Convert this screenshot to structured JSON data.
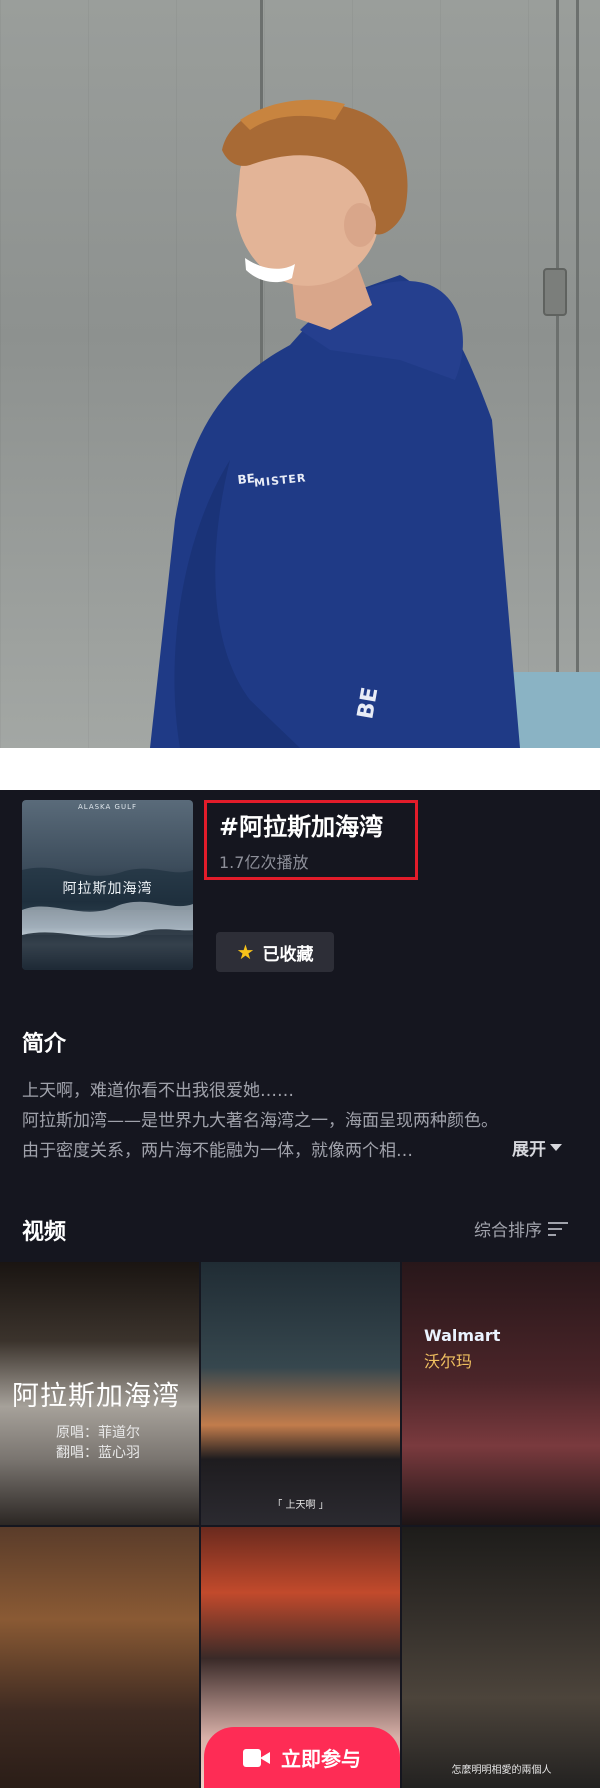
{
  "topic": {
    "cover_top_text": "ALASKA GULF",
    "cover_title": "阿拉斯加海湾",
    "title": "#阿拉斯加海湾",
    "plays": "1.7亿次播放",
    "favorite_label": "已收藏",
    "highlight_color": "#e21c2a"
  },
  "intro": {
    "heading": "简介",
    "lines": [
      "上天啊，难道你看不出我很爱她……",
      "阿拉斯加湾——是世界九大著名海湾之一，海面呈现两种颜色。",
      "由于密度关系，两片海不能融为一体，就像两个相…"
    ],
    "expand_label": "展开"
  },
  "videos": {
    "heading": "视频",
    "sort_label": "综合排序",
    "items": [
      {
        "title": "阿拉斯加海湾",
        "sub1": "原唱：菲道尔",
        "sub2": "翻唱：蓝心羽"
      },
      {
        "caption": "「 上天啊 」"
      },
      {
        "sign": "Walmart",
        "sign_cn": "沃尔玛"
      },
      {},
      {},
      {
        "caption": "怎麼明明相愛的兩個人"
      }
    ]
  },
  "join_button": {
    "label": "立即参与",
    "color": "#fe2c55"
  },
  "photo": {
    "shirt_text": "MISTER"
  }
}
